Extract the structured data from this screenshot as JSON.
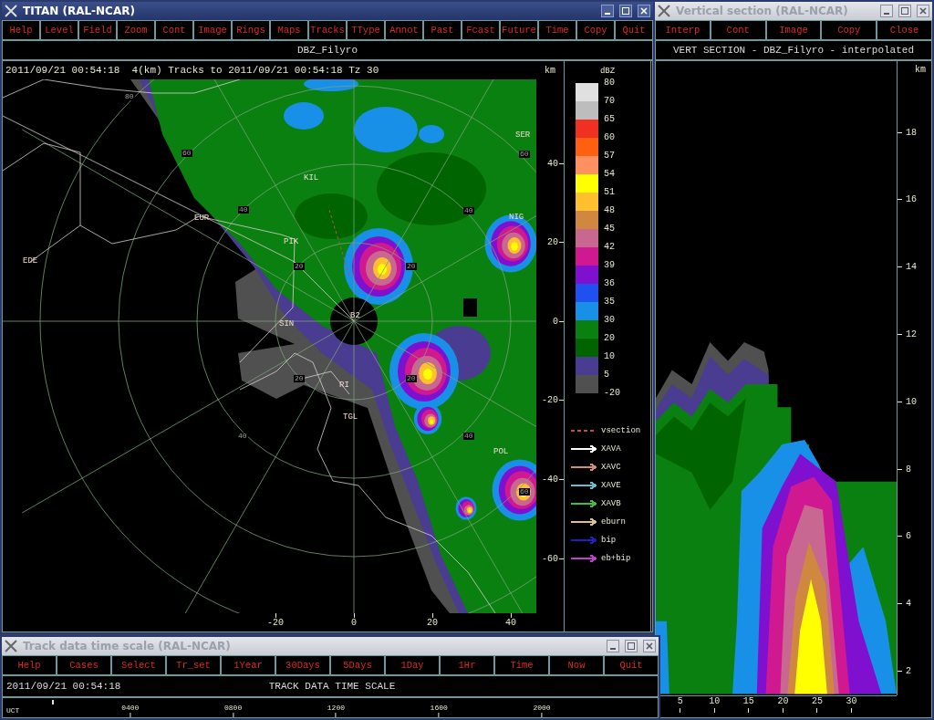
{
  "main_window": {
    "title": "TITAN (RAL-NCAR)",
    "active": true,
    "menu": [
      "Help",
      "Level",
      "Field",
      "Zoom",
      "Cont",
      "Image",
      "Rings",
      "Maps",
      "Tracks",
      "TType",
      "Annot",
      "Past",
      "Fcast",
      "Future",
      "Time",
      "Copy",
      "Quit"
    ],
    "field": "DBZ_Filyro",
    "plot_header": "2011/09/21 00:54:18  4(km) Tracks to 2011/09/21 00:54:18 Tz 30",
    "y_unit": "km",
    "stations": [
      "SER",
      "KIL",
      "NIG",
      "EUR",
      "PIK",
      "EDE",
      "B2",
      "SIN",
      "RI",
      "TGL",
      "POL"
    ],
    "range_labels": [
      "80",
      "60",
      "40",
      "20",
      "20",
      "40",
      "60",
      "20",
      "20",
      "40",
      "60",
      "40"
    ],
    "y_ticks": [
      "40",
      "20",
      "0",
      "-20",
      "-40",
      "-60"
    ],
    "x_ticks": [
      "-20",
      "0",
      "20",
      "40"
    ],
    "legend": {
      "unit": "dBZ",
      "scale": [
        {
          "label": "80",
          "color": "#e0e0e0"
        },
        {
          "label": "70",
          "color": "#bdbdbd"
        },
        {
          "label": "65",
          "color": "#f03020"
        },
        {
          "label": "60",
          "color": "#ff6010"
        },
        {
          "label": "57",
          "color": "#ff9060"
        },
        {
          "label": "54",
          "color": "#ffff00"
        },
        {
          "label": "51",
          "color": "#ffc030"
        },
        {
          "label": "48",
          "color": "#d08840"
        },
        {
          "label": "45",
          "color": "#c86890"
        },
        {
          "label": "42",
          "color": "#d01890"
        },
        {
          "label": "39",
          "color": "#8010d0"
        },
        {
          "label": "36",
          "color": "#2050f0"
        },
        {
          "label": "35",
          "color": "#1890e8"
        },
        {
          "label": "30",
          "color": "#0a8010"
        },
        {
          "label": "20",
          "color": "#006400"
        },
        {
          "label": "10",
          "color": "#4a3c90"
        },
        {
          "label": "5",
          "color": "#505050"
        },
        {
          "label": "-20"
        }
      ],
      "tracks": [
        {
          "label": "vsection",
          "kind": "dashed",
          "color": "#c05050"
        },
        {
          "label": "XAVA",
          "kind": "arrow",
          "color": "#ffffff"
        },
        {
          "label": "XAVC",
          "kind": "arrow",
          "color": "#d09070"
        },
        {
          "label": "XAVE",
          "kind": "arrow",
          "color": "#60c0d0"
        },
        {
          "label": "XAVB",
          "kind": "arrow",
          "color": "#40c040"
        },
        {
          "label": "eburn",
          "kind": "arrow",
          "color": "#e0c090"
        },
        {
          "label": "bip",
          "kind": "arrow",
          "color": "#2020c0"
        },
        {
          "label": "eb+bip",
          "kind": "arrow",
          "color": "#c040d0"
        }
      ]
    }
  },
  "vertical_window": {
    "title": "Vertical section (RAL-NCAR)",
    "active": false,
    "menu": [
      "Interp",
      "Cont",
      "Image",
      "Copy",
      "Close"
    ],
    "heading": "VERT SECTION - DBZ_Filyro - interpolated",
    "y_unit": "km",
    "y_ticks": [
      "18",
      "16",
      "14",
      "12",
      "10",
      "8",
      "6",
      "4",
      "2"
    ],
    "x_ticks": [
      "5",
      "10",
      "15",
      "20",
      "25",
      "30"
    ]
  },
  "track_window": {
    "title": "Track data time scale (RAL-NCAR)",
    "active": false,
    "menu": [
      "Help",
      "Cases",
      "Select",
      "Tr_set",
      "1Year",
      "30Days",
      "5Days",
      "1Day",
      "1Hr",
      "Time",
      "Now",
      "Quit"
    ],
    "time": "2011/09/21 00:54:18",
    "heading": "TRACK DATA TIME SCALE",
    "axis_label": "UCT",
    "ticks": [
      "0400",
      "0800",
      "1200",
      "1600",
      "2000"
    ]
  }
}
